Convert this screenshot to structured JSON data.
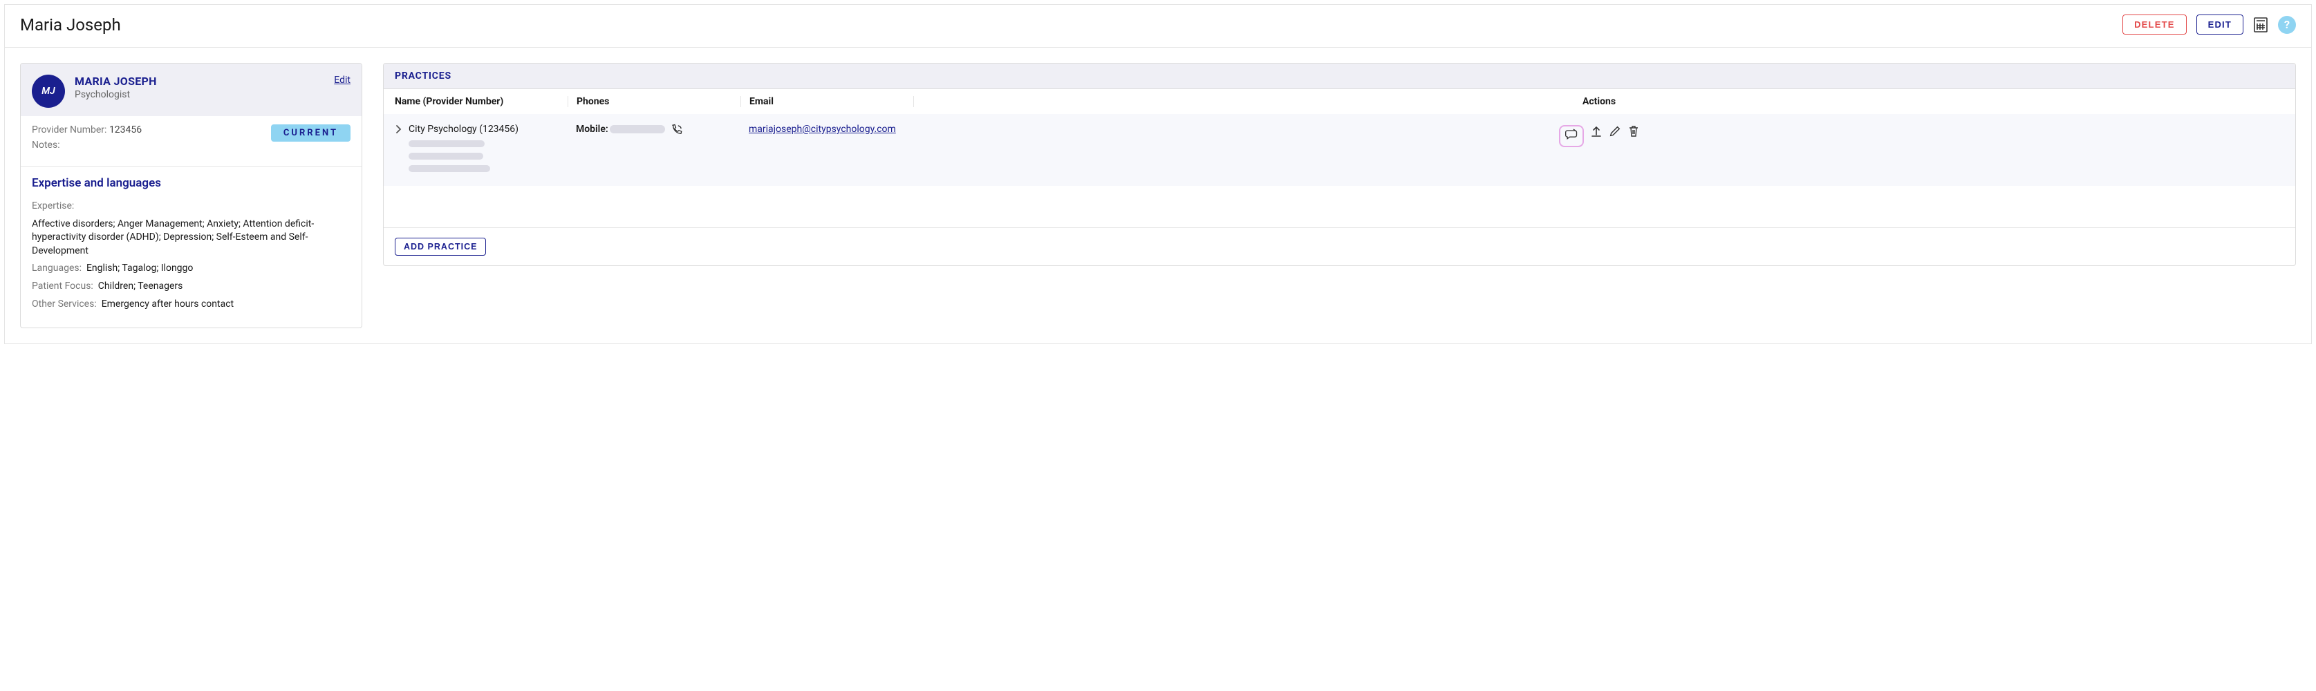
{
  "header": {
    "title": "Maria Joseph",
    "delete_label": "DELETE",
    "edit_label": "EDIT"
  },
  "profile": {
    "initials": "MJ",
    "name": "MARIA JOSEPH",
    "role": "Psychologist",
    "edit_link": "Edit",
    "provider_number_label": "Provider Number:",
    "provider_number": "123456",
    "notes_label": "Notes:",
    "status_badge": "CURRENT"
  },
  "expertise": {
    "section_title": "Expertise and languages",
    "expertise_label": "Expertise:",
    "expertise_value": "Affective disorders; Anger Management; Anxiety; Attention deficit-hyperactivity disorder (ADHD); Depression; Self-Esteem and Self-Development",
    "languages_label": "Languages:",
    "languages_value": "English; Tagalog; Ilonggo",
    "focus_label": "Patient Focus:",
    "focus_value": "Children; Teenagers",
    "other_label": "Other Services:",
    "other_value": "Emergency after hours contact"
  },
  "practices": {
    "panel_title": "PRACTICES",
    "columns": {
      "name": "Name (Provider Number)",
      "phones": "Phones",
      "email": "Email",
      "actions": "Actions"
    },
    "row": {
      "name": "City Psychology (123456)",
      "phone_label": "Mobile:",
      "email": "mariajoseph@citypsychology.com"
    },
    "add_label": "ADD PRACTICE"
  }
}
